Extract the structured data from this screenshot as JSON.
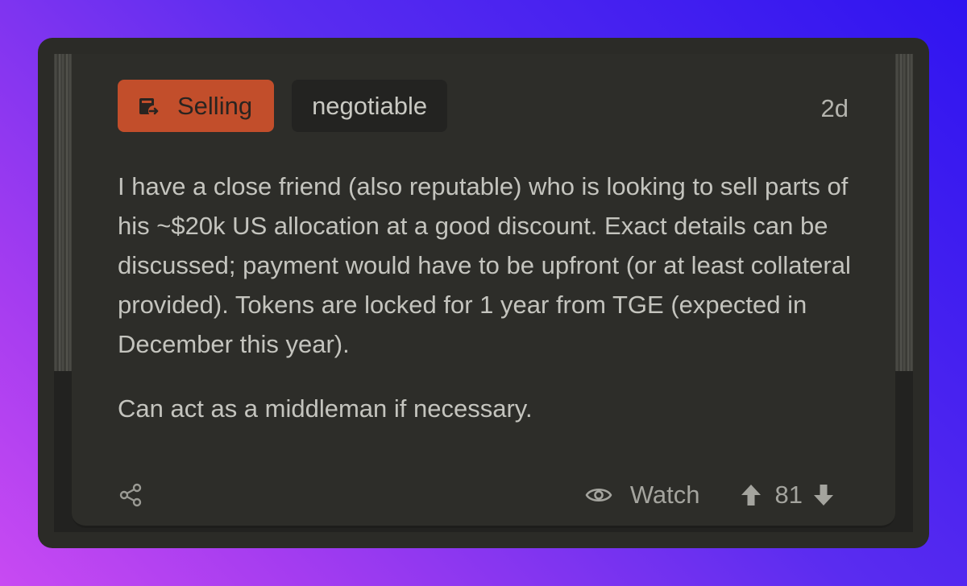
{
  "post": {
    "tags": [
      {
        "label": "Selling",
        "icon": "sell-tag-icon",
        "color": "#c24e2b"
      },
      {
        "label": "negotiable"
      }
    ],
    "time_ago": "2d",
    "paragraphs": [
      "I have a close friend (also reputable) who is looking to sell parts of his ~$20k US allocation at a good discount. Exact details can be discussed; payment would have to be upfront (or at least collateral provided). Tokens are locked for 1 year from TGE (expected in December this year).",
      "Can act as a middleman if necessary."
    ],
    "actions": {
      "share_icon": "share-icon",
      "watch_label": "Watch",
      "watch_icon": "eye-icon",
      "vote_count": "81",
      "upvote_icon": "arrow-up-icon",
      "downvote_icon": "arrow-down-icon"
    }
  }
}
